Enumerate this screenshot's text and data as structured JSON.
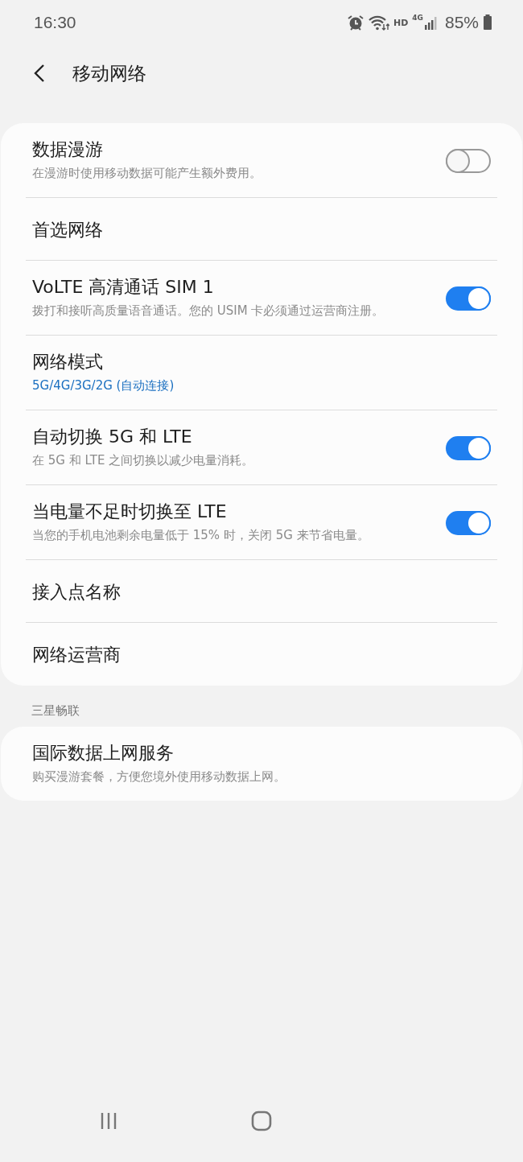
{
  "status_bar": {
    "time": "16:30",
    "hd": "HD",
    "network": "4G",
    "battery": "85%"
  },
  "header": {
    "title": "移动网络"
  },
  "sections": [
    {
      "rows": [
        {
          "kind": "toggle",
          "title": "数据漫游",
          "subtitle": "在漫游时使用移动数据可能产生额外费用。",
          "on": false
        },
        {
          "kind": "plain",
          "title": "首选网络"
        },
        {
          "kind": "toggle",
          "title": "VoLTE 高清通话 SIM 1",
          "subtitle": "拨打和接听高质量语音通话。您的 USIM 卡必须通过运营商注册。",
          "on": true
        },
        {
          "kind": "value",
          "title": "网络模式",
          "subtitle": "5G/4G/3G/2G (自动连接)"
        },
        {
          "kind": "toggle",
          "title": "自动切换 5G 和 LTE",
          "subtitle": "在 5G 和 LTE 之间切换以减少电量消耗。",
          "on": true
        },
        {
          "kind": "toggle",
          "title": "当电量不足时切换至 LTE",
          "subtitle": "当您的手机电池剩余电量低于 15% 时，关闭 5G 来节省电量。",
          "on": true
        },
        {
          "kind": "plain",
          "title": "接入点名称"
        },
        {
          "kind": "plain",
          "title": "网络运营商"
        }
      ]
    },
    {
      "header": "三星畅联",
      "rows": [
        {
          "kind": "plain",
          "title": "国际数据上网服务",
          "subtitle": "购买漫游套餐，方便您境外使用移动数据上网。"
        }
      ]
    }
  ]
}
